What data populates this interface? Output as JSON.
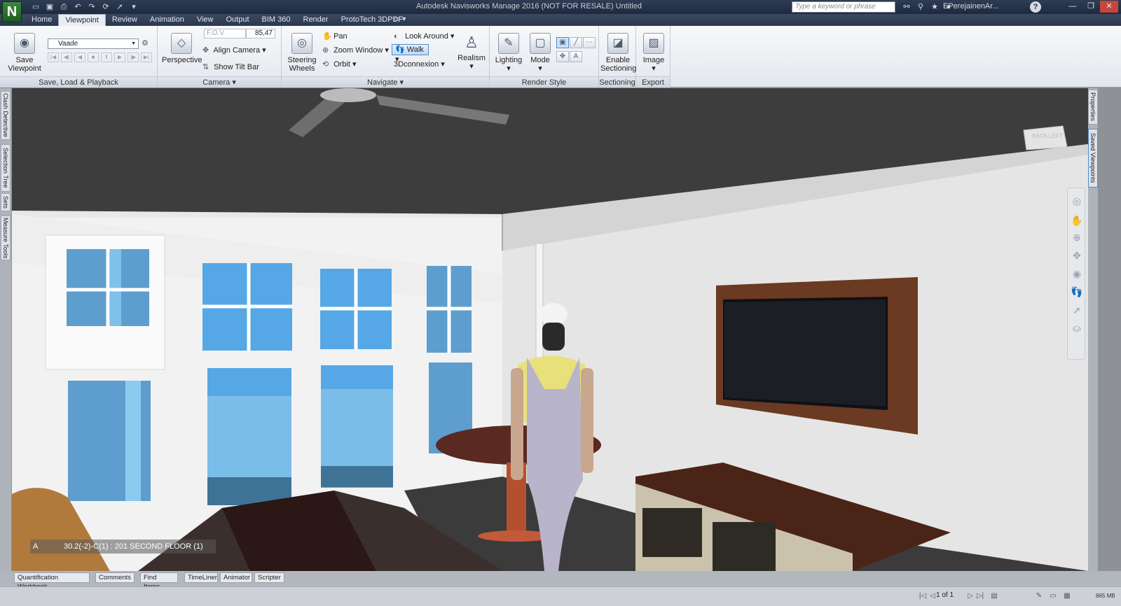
{
  "window": {
    "title": "Autodesk Navisworks Manage 2016 (NOT FOR RESALE)    Untitled",
    "logo": "N",
    "search_placeholder": "Type a keyword or phrase",
    "user": "EPerejainenAr...",
    "help": "?"
  },
  "qat_icons": [
    "open-icon",
    "save-icon",
    "print-icon",
    "undo-icon",
    "redo-icon",
    "refresh-icon",
    "select-icon"
  ],
  "tabs": [
    "Home",
    "Viewpoint",
    "Review",
    "Animation",
    "View",
    "Output",
    "BIM 360",
    "Render",
    "ProtoTech 3DPDF"
  ],
  "active_tab": "Viewpoint",
  "ribbon": {
    "save_load": {
      "save_viewpoint": "Save Viewpoint",
      "viewpoint_select": "Vaade",
      "label": "Save, Load & Playback"
    },
    "camera": {
      "perspective": "Perspective",
      "fov_label": "F.O.V",
      "fov_value": "85,47",
      "align_camera": "Align Camera",
      "show_tilt_bar": "Show Tilt Bar",
      "label": "Camera"
    },
    "navigate": {
      "steering_wheels": "Steering Wheels",
      "pan": "Pan",
      "zoom_window": "Zoom Window",
      "orbit": "Orbit",
      "look_around": "Look Around",
      "walk": "Walk",
      "connexion": "3Dconnexion",
      "realism": "Realism",
      "label": "Navigate"
    },
    "render_style": {
      "lighting": "Lighting",
      "mode": "Mode",
      "label": "Render Style"
    },
    "sectioning": {
      "enable": "Enable Sectioning",
      "label": "Sectioning"
    },
    "export": {
      "image": "Image",
      "label": "Export"
    }
  },
  "left_dock": [
    "Clash Detective",
    "Selection Tree",
    "Sets",
    "Measure Tools"
  ],
  "right_dock": [
    "Properties",
    "Saved Viewpoints"
  ],
  "viewcube": {
    "back": "BACK",
    "left": "LEFT"
  },
  "viewport_overlay": {
    "left": "A",
    "right": "30.2(-2)-C(1) : 201 SECOND FLOOR (1)"
  },
  "bottom_tabs": [
    "Quantification Workbook",
    "Comments",
    "Find Items",
    "TimeLiner",
    "Animator",
    "Scripter"
  ],
  "status": {
    "pager": "1 of 1",
    "memory": "865 MB"
  },
  "colors": {
    "accent": "#4f8dd0",
    "titlebar": "#1f2a3f",
    "ceiling": "#3d3d3d",
    "wall": "#e6e6e6",
    "glass": "#5aaae6"
  }
}
